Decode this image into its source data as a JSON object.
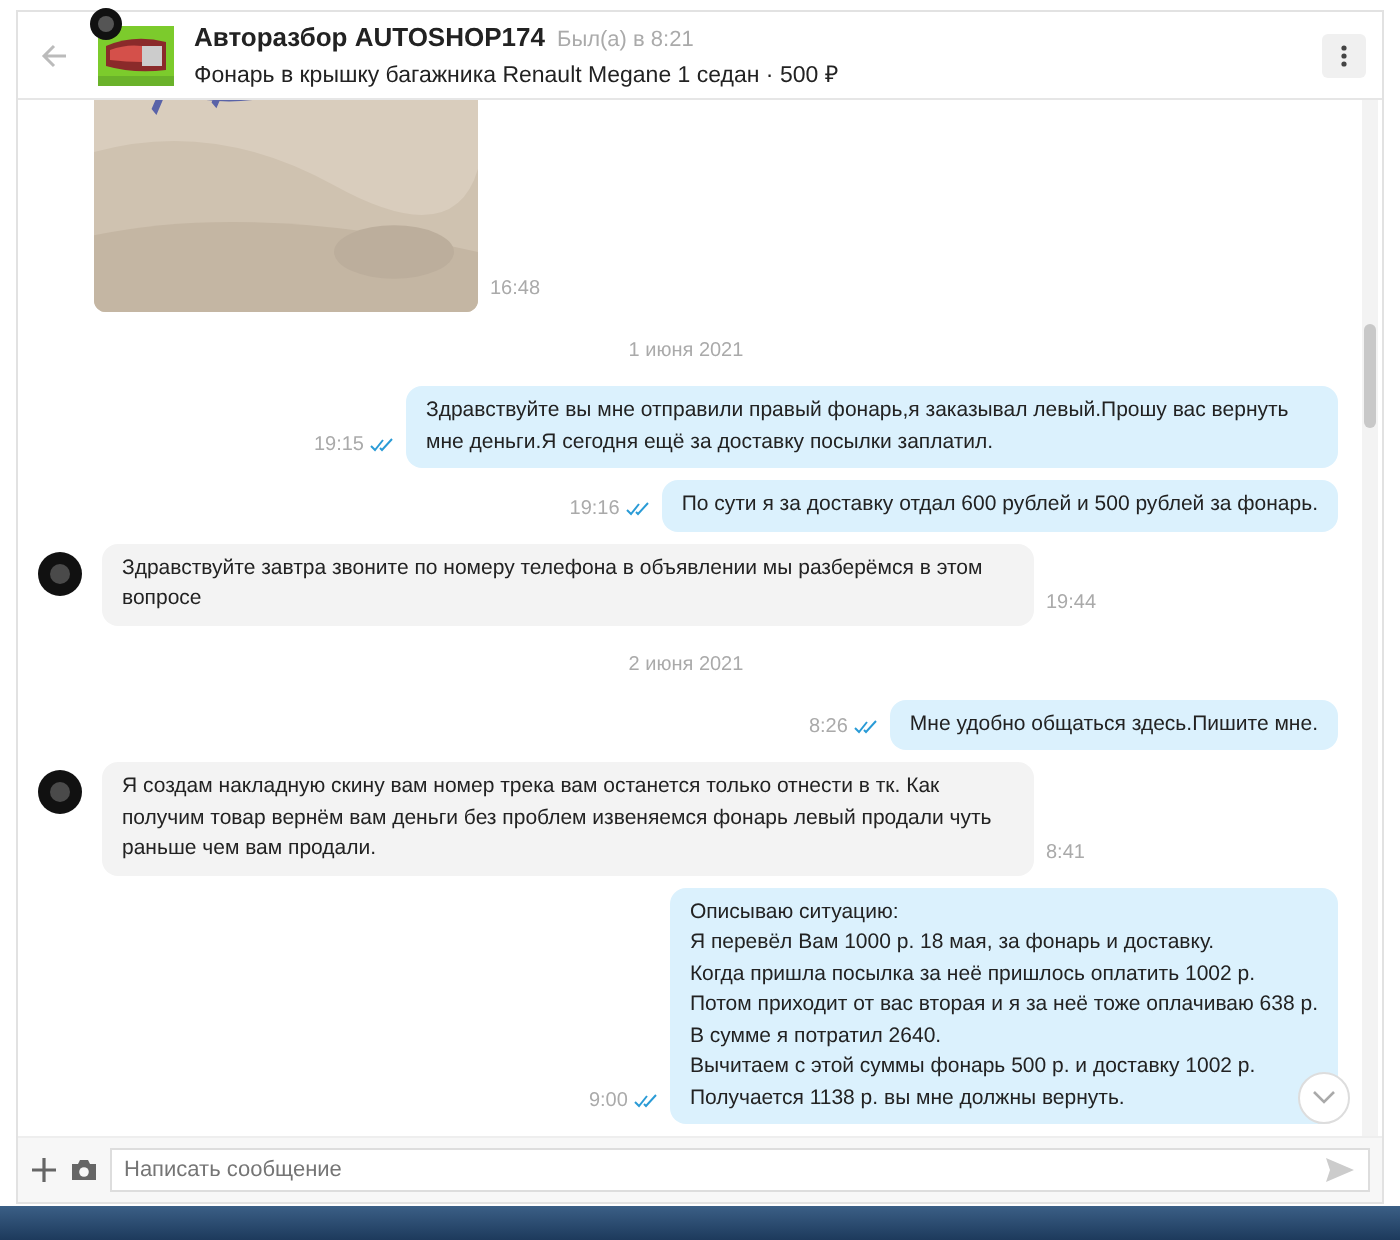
{
  "header": {
    "name": "Авторазбор AUTOSHOP174",
    "last_seen": "Был(а) в 8:21",
    "item": "Фонарь в крышку багажника Renault Megane 1 седан · 500 ₽"
  },
  "messages": [
    {
      "kind": "picture",
      "outgoing": false,
      "time": "16:48"
    },
    {
      "kind": "date",
      "text": "1 июня 2021"
    },
    {
      "kind": "text",
      "outgoing": true,
      "read": true,
      "time": "19:15",
      "text": "Здравствуйте вы мне отправили правый фонарь,я заказывал левый.Прошу вас вернуть мне деньги.Я сегодня ещё за доставку посылки  заплатил."
    },
    {
      "kind": "text",
      "outgoing": true,
      "read": true,
      "time": "19:16",
      "text": "По сути я за доставку отдал 600 рублей и 500 рублей за фонарь."
    },
    {
      "kind": "text",
      "outgoing": false,
      "time": "19:44",
      "text": "Здравствуйте завтра звоните по номеру телефона в объявлении мы разберёмся в этом вопросе"
    },
    {
      "kind": "date",
      "text": "2 июня 2021"
    },
    {
      "kind": "text",
      "outgoing": true,
      "read": true,
      "time": "8:26",
      "text": "Мне удобно общаться здесь.Пишите мне."
    },
    {
      "kind": "text",
      "outgoing": false,
      "time": "8:41",
      "text": "Я создам накладную скину вам номер трека вам останется только отнести в тк. Как получим товар вернём вам деньги без проблем извеняемся фонарь левый продали чуть раньше чем вам продали."
    },
    {
      "kind": "text",
      "outgoing": true,
      "read": true,
      "time": "9:00",
      "text": "Описываю ситуацию:\nЯ перевёл Вам 1000 р. 18 мая, за фонарь и доставку.\nКогда пришла посылка за неё пришлось оплатить 1002 р.\nПотом приходит от вас вторая и я за неё тоже оплачиваю 638 р.\nВ сумме я потратил 2640.\nВычитаем с этой суммы фонарь 500 р. и доставку 1002 р.\nПолучается 1138 р. вы мне должны вернуть."
    }
  ],
  "composer": {
    "placeholder": "Написать сообщение"
  }
}
